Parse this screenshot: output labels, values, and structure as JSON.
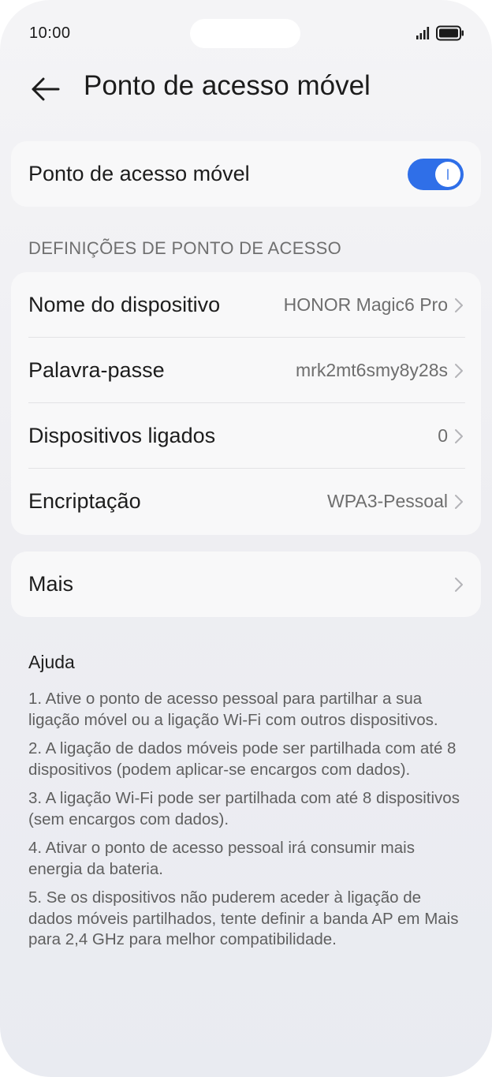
{
  "status_bar": {
    "time": "10:00",
    "signal_icon": "cellular-signal-icon",
    "battery_icon": "battery-full-icon"
  },
  "header": {
    "back_icon": "arrow-left-icon",
    "title": "Ponto de acesso móvel"
  },
  "hotspot": {
    "label": "Ponto de acesso móvel",
    "enabled": true,
    "toggle_color": "#2f6fe8"
  },
  "settings_section": {
    "title": "DEFINIÇÕES DE PONTO DE ACESSO",
    "items": [
      {
        "label": "Nome do dispositivo",
        "value": "HONOR Magic6 Pro"
      },
      {
        "label": "Palavra-passe",
        "value": "mrk2mt6smy8y28s"
      },
      {
        "label": "Dispositivos ligados",
        "value": "0"
      },
      {
        "label": "Encriptação",
        "value": "WPA3-Pessoal"
      }
    ]
  },
  "more": {
    "label": "Mais"
  },
  "help": {
    "title": "Ajuda",
    "items": [
      "1. Ative o ponto de acesso pessoal para partilhar a sua ligação móvel ou a ligação Wi-Fi com outros dispositivos.",
      "2. A ligação de dados móveis pode ser partilhada com até 8 dispositivos (podem aplicar-se encargos com dados).",
      "3. A ligação Wi-Fi pode ser partilhada com até 8 dispositivos (sem encargos com dados).",
      "4. Ativar o ponto de acesso pessoal irá consumir mais energia da bateria.",
      "5. Se os dispositivos não puderem aceder à ligação de dados móveis partilhados, tente definir a banda AP em Mais para 2,4 GHz para melhor compatibilidade."
    ]
  }
}
